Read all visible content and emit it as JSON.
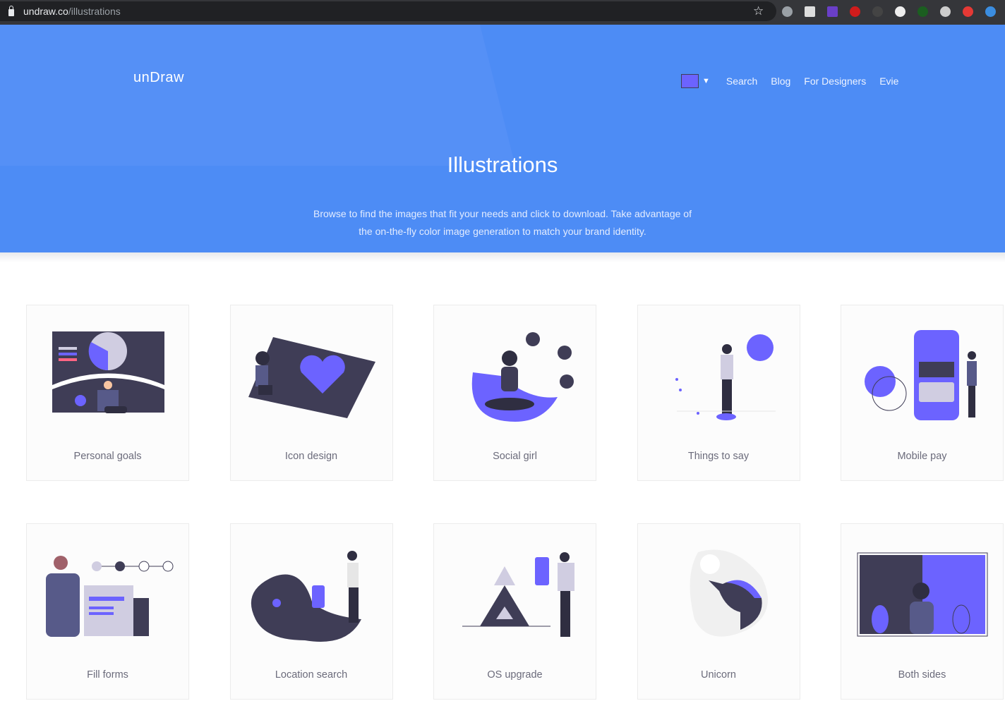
{
  "browser": {
    "url_host": "undraw.co",
    "url_path": "/illustrations"
  },
  "header": {
    "logo": "unDraw",
    "nav": [
      "Search",
      "Blog",
      "For Designers",
      "Evie"
    ],
    "color_picker": "#6c63ff"
  },
  "hero": {
    "title": "Illustrations",
    "subtitle_line1": "Browse to find the images that fit your needs and click to download. Take advantage of",
    "subtitle_line2": "the on-the-fly color image generation to match your brand identity."
  },
  "colors": {
    "brand_blue": "#4d8cf5",
    "accent": "#6c63ff",
    "dark": "#3f3d56"
  },
  "illustrations": [
    {
      "title": "Personal goals"
    },
    {
      "title": "Icon design"
    },
    {
      "title": "Social girl"
    },
    {
      "title": "Things to say"
    },
    {
      "title": "Mobile pay"
    },
    {
      "title": "Fill forms"
    },
    {
      "title": "Location search"
    },
    {
      "title": "OS upgrade"
    },
    {
      "title": "Unicorn"
    },
    {
      "title": "Both sides"
    }
  ]
}
